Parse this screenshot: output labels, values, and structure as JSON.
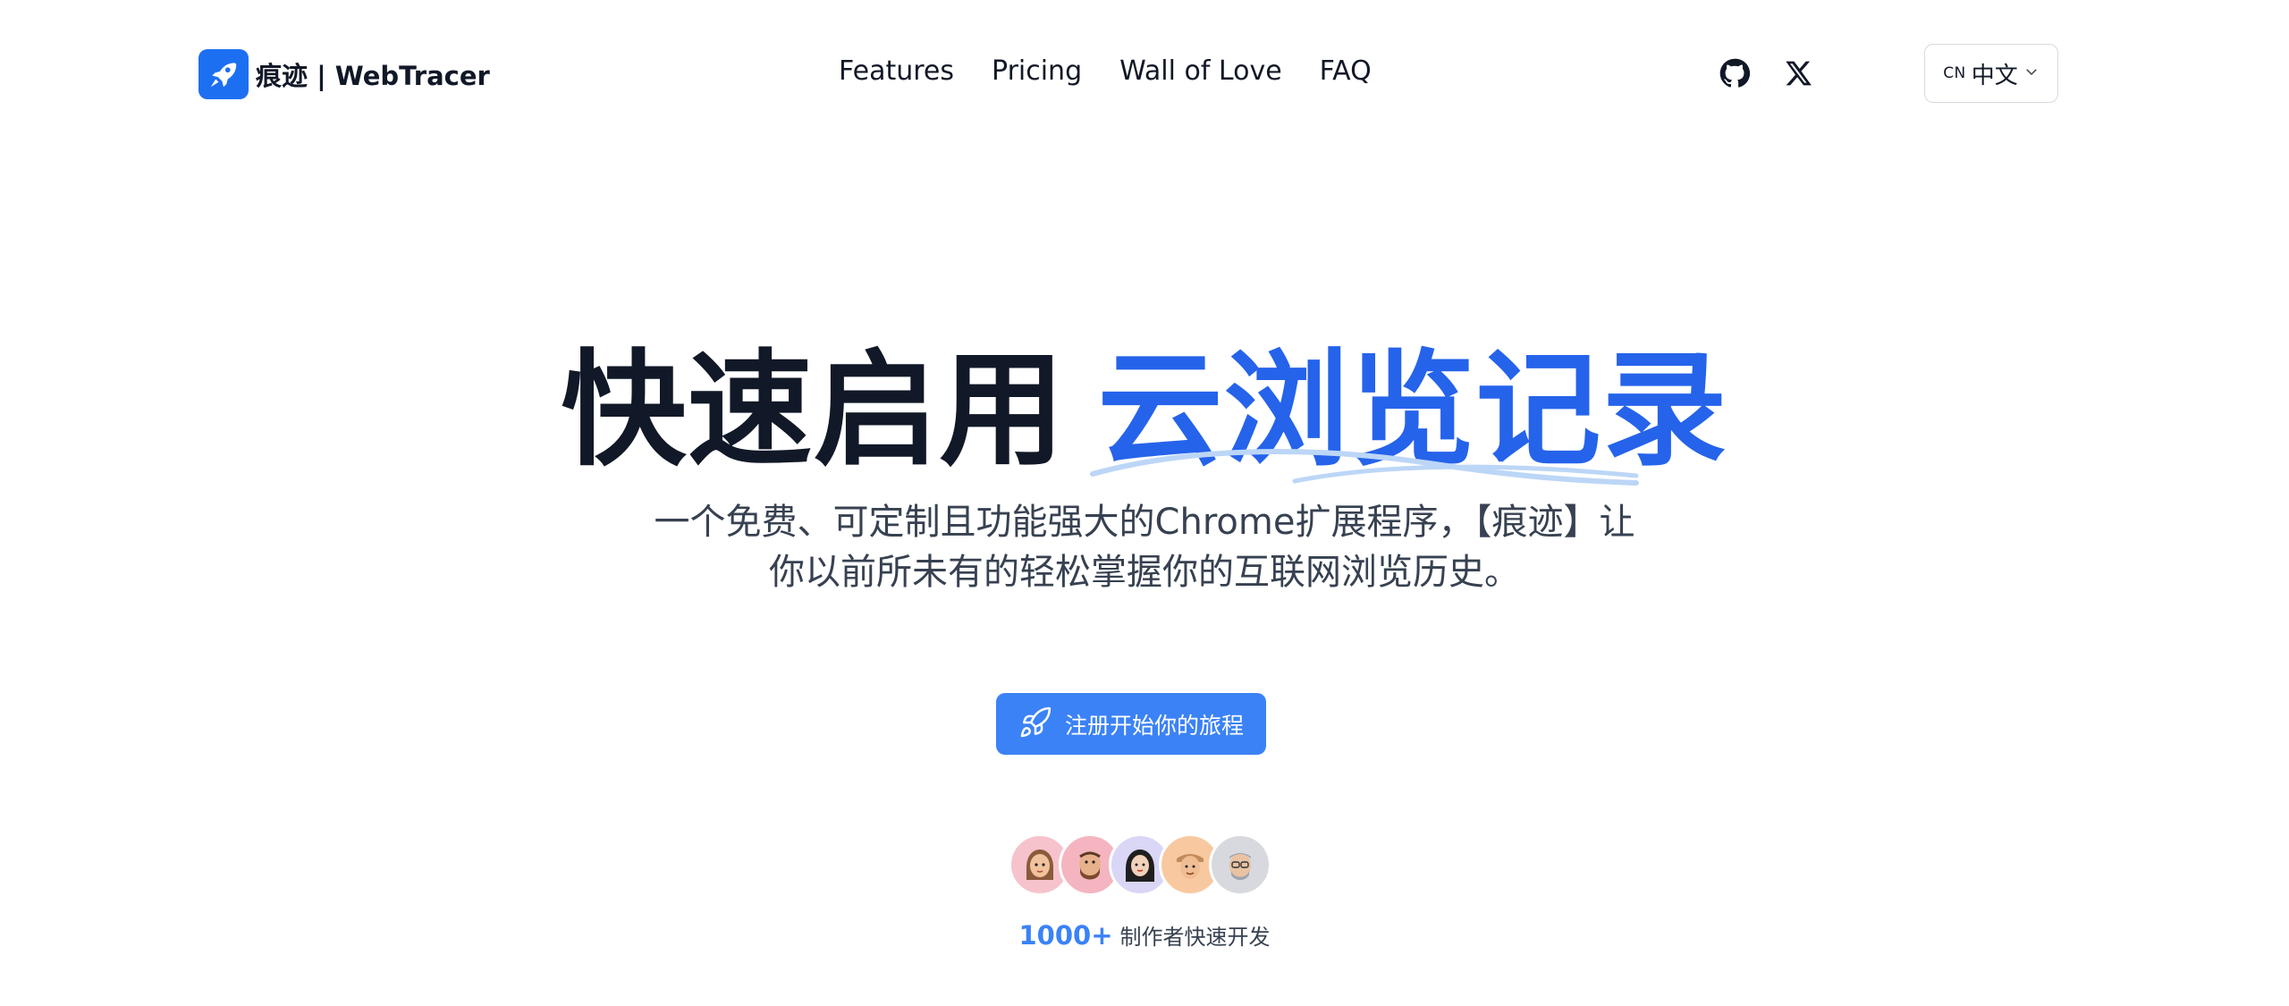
{
  "header": {
    "brand_name": "痕迹 | WebTracer",
    "nav": [
      "Features",
      "Pricing",
      "Wall of Love",
      "FAQ"
    ],
    "language": {
      "code": "CN",
      "label": "中文"
    }
  },
  "hero": {
    "title_dark": "快速启用",
    "title_accent": "云浏览记录",
    "subtitle_line1": "一个免费、可定制且功能强大的Chrome扩展程序，【痕迹】让",
    "subtitle_line2": "你以前所未有的轻松掌握你的互联网浏览历史。",
    "cta_label": "注册开始你的旅程"
  },
  "social_proof": {
    "count": "1000+",
    "text": "制作者快速开发",
    "avatar_colors": [
      "#f6c3cc",
      "#f4b5c0",
      "#d9d6f6",
      "#f8c9a0",
      "#d7d9de"
    ]
  },
  "colors": {
    "accent": "#2563eb",
    "cta": "#3b82f6",
    "brand": "#1d6ff2"
  },
  "icons": [
    "rocket-icon",
    "github-icon",
    "x-icon",
    "chevron-down-icon"
  ]
}
